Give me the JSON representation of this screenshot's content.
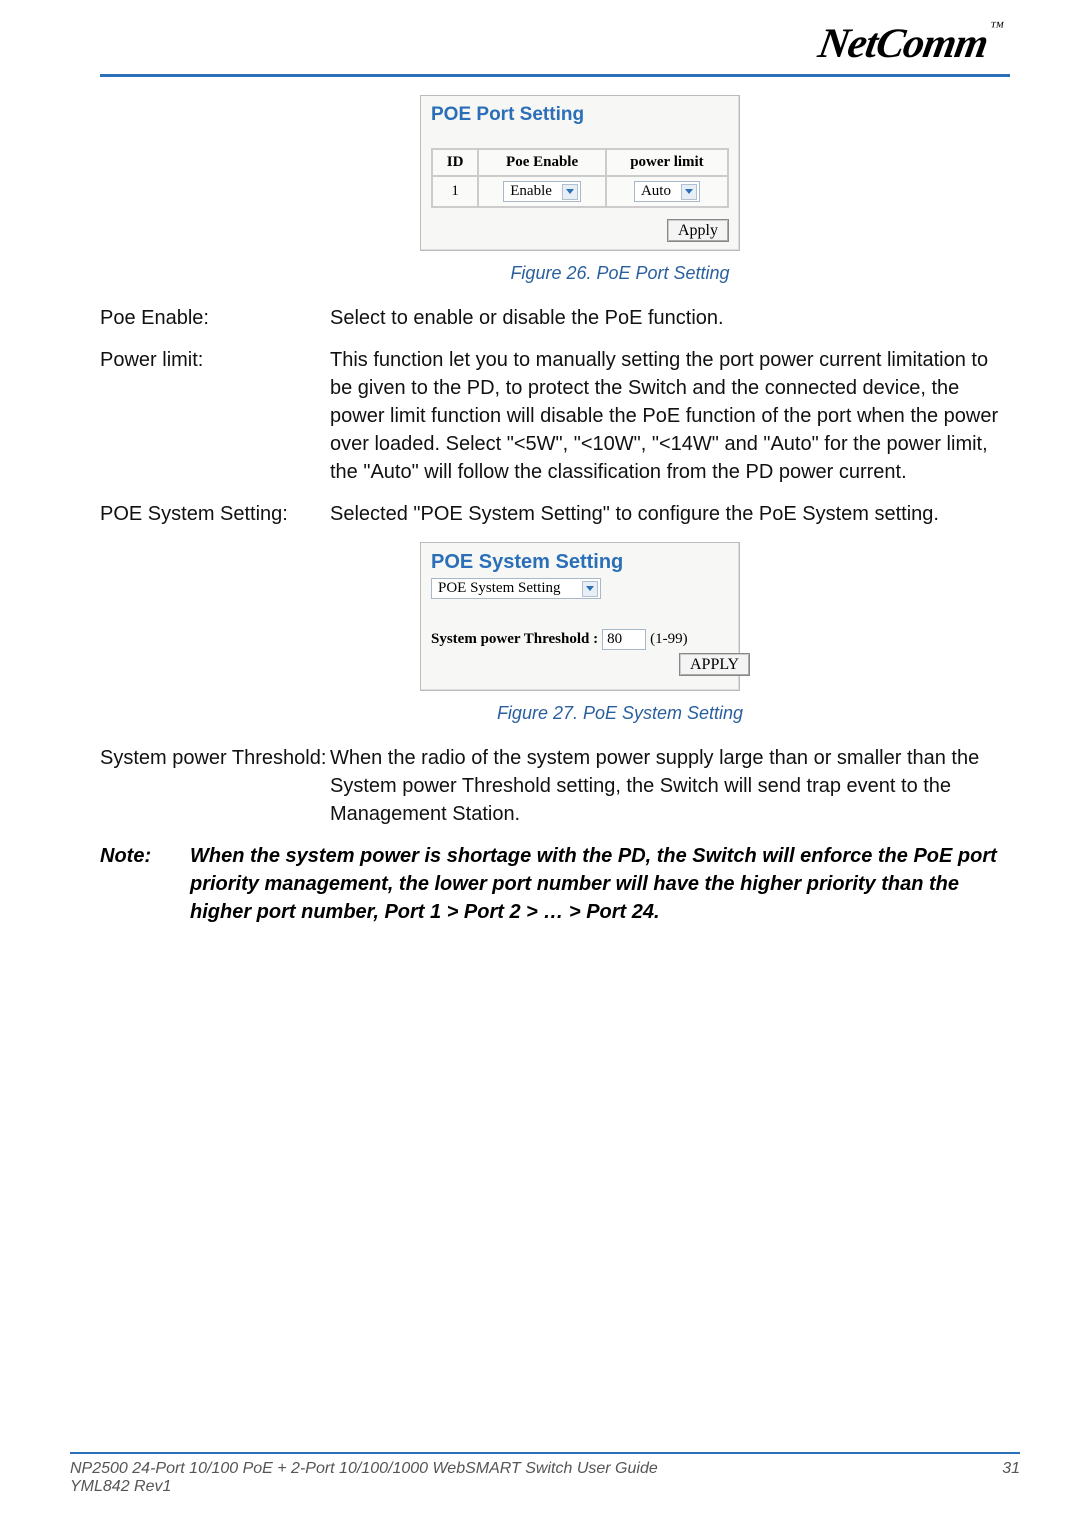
{
  "brand": "NetComm",
  "brand_tm": "™",
  "panel1": {
    "title": "POE Port Setting",
    "columns": {
      "id": "ID",
      "enable": "Poe Enable",
      "limit": "power limit"
    },
    "row": {
      "id": "1",
      "enable_value": "Enable",
      "limit_value": "Auto"
    },
    "apply": "Apply"
  },
  "figure26": "Figure 26.  PoE Port Setting",
  "defs": {
    "poe_enable": {
      "term": "Poe Enable:",
      "body": "Select to enable or disable the PoE function."
    },
    "power_limit": {
      "term": "Power limit:",
      "body": "This function let you to manually setting the port power current limitation to be given to the PD, to protect the Switch and the connected device, the power limit function will disable the PoE function of the port when the power over loaded. Select \"<5W\", \"<10W\", \"<14W\" and \"Auto\" for the power limit, the \"Auto\" will follow the classification from the PD power current."
    },
    "poe_system": {
      "term": "POE System Setting:",
      "body": "Selected \"POE System Setting\" to configure the PoE System setting."
    }
  },
  "panel2": {
    "title": "POE System Setting",
    "select_value": "POE System Setting",
    "threshold_label": "System power Threshold :",
    "threshold_value": "80",
    "threshold_range": "(1-99)",
    "apply": "APPLY"
  },
  "figure27": "Figure 27. PoE System Setting",
  "defs2": {
    "sys_power": {
      "term": "System power Threshold:",
      "body": "When the radio of the system power supply large than or smaller than the System power Threshold setting, the Switch will send trap event to the Management Station."
    }
  },
  "note": {
    "label": "Note:",
    "body": "When the system power is shortage with the PD, the Switch will enforce the PoE port priority management, the lower port number will have the higher priority than the higher port number, Port 1 > Port 2 > … > Port 24."
  },
  "footer": {
    "guide": "NP2500 24-Port 10/100 PoE + 2-Port 10/100/1000 WebSMART Switch User Guide",
    "page": "31",
    "rev": "YML842 Rev1"
  }
}
